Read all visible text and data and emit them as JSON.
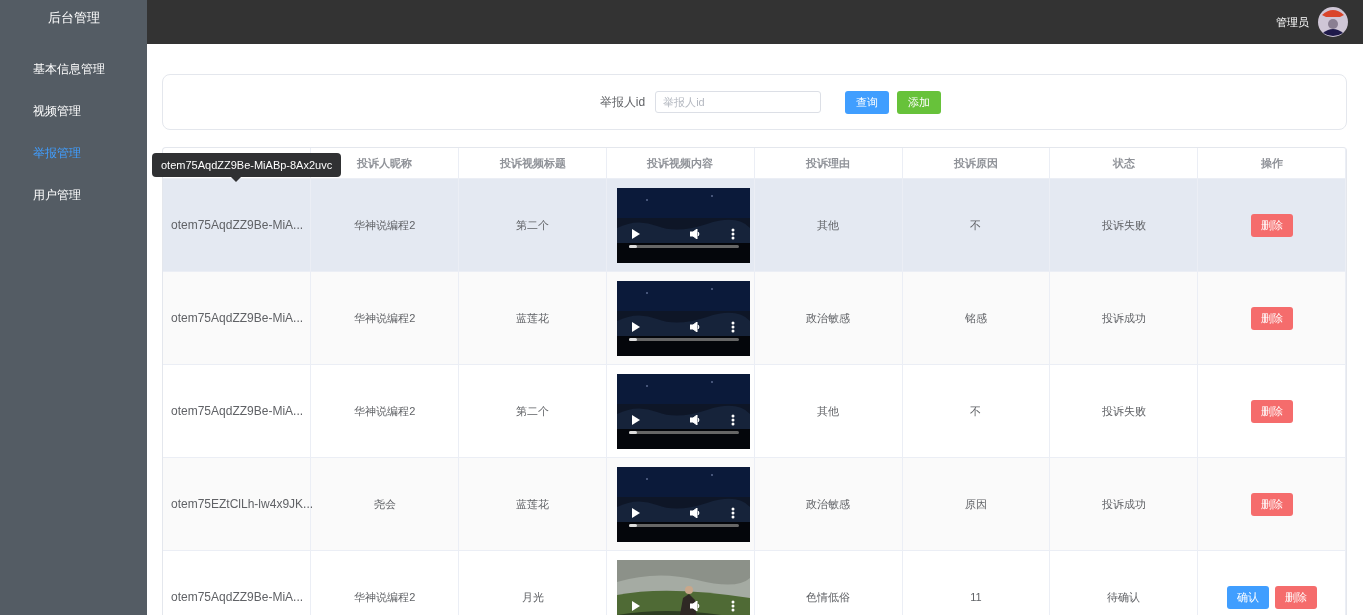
{
  "sidebar": {
    "title": "后台管理",
    "items": [
      {
        "label": "基本信息管理",
        "selected": false
      },
      {
        "label": "视频管理",
        "selected": false
      },
      {
        "label": "举报管理",
        "selected": true
      },
      {
        "label": "用户管理",
        "selected": false
      }
    ]
  },
  "header": {
    "user": "管理员"
  },
  "search": {
    "label": "举报人id",
    "placeholder": "举报人id",
    "buttons": [
      {
        "label": "查询",
        "kind": "primary"
      },
      {
        "label": "添加",
        "kind": "success"
      }
    ]
  },
  "table": {
    "columns": [
      "投诉人昵称",
      "投诉视频标题",
      "投诉视频内容",
      "投诉理由",
      "投诉原因",
      "状态",
      "操作"
    ],
    "tooltip": "otem75AqdZZ9Be-MiABp-8Ax2uvc",
    "rows": [
      {
        "highlighted": true,
        "reporter_id": "otem75AqdZZ9Be-MiA...",
        "nickname": "华神说编程2",
        "title": "第二个",
        "video": {
          "kind": "picture"
        },
        "reason": "其他",
        "cause": "不",
        "status": "投诉失败",
        "actions": [
          {
            "label": "删除",
            "kind": "danger"
          }
        ]
      },
      {
        "highlighted": false,
        "reporter_id": "otem75AqdZZ9Be-MiA...",
        "nickname": "华神说编程2",
        "title": "蓝莲花",
        "video": {
          "kind": "picture"
        },
        "reason": "政治敏感",
        "cause": "铭感",
        "status": "投诉成功",
        "actions": [
          {
            "label": "删除",
            "kind": "danger"
          }
        ]
      },
      {
        "highlighted": false,
        "reporter_id": "otem75AqdZZ9Be-MiA...",
        "nickname": "华神说编程2",
        "title": "第二个",
        "video": {
          "kind": "picture"
        },
        "reason": "其他",
        "cause": "不",
        "status": "投诉失败",
        "actions": [
          {
            "label": "删除",
            "kind": "danger"
          }
        ]
      },
      {
        "highlighted": false,
        "reporter_id": "otem75EZtClLh-lw4x9JK...",
        "nickname": "尧会",
        "title": "蓝莲花",
        "video": {
          "kind": "picture"
        },
        "reason": "政治敏感",
        "cause": "原因",
        "status": "投诉成功",
        "actions": [
          {
            "label": "删除",
            "kind": "danger"
          }
        ]
      },
      {
        "highlighted": false,
        "reporter_id": "otem75AqdZZ9Be-MiA...",
        "nickname": "华神说编程2",
        "title": "月光",
        "video": {
          "kind": "picture"
        },
        "reason": "色情低俗",
        "cause": "11",
        "status": "待确认",
        "actions": [
          {
            "label": "确认",
            "kind": "primary"
          },
          {
            "label": "删除",
            "kind": "danger"
          }
        ]
      }
    ]
  }
}
